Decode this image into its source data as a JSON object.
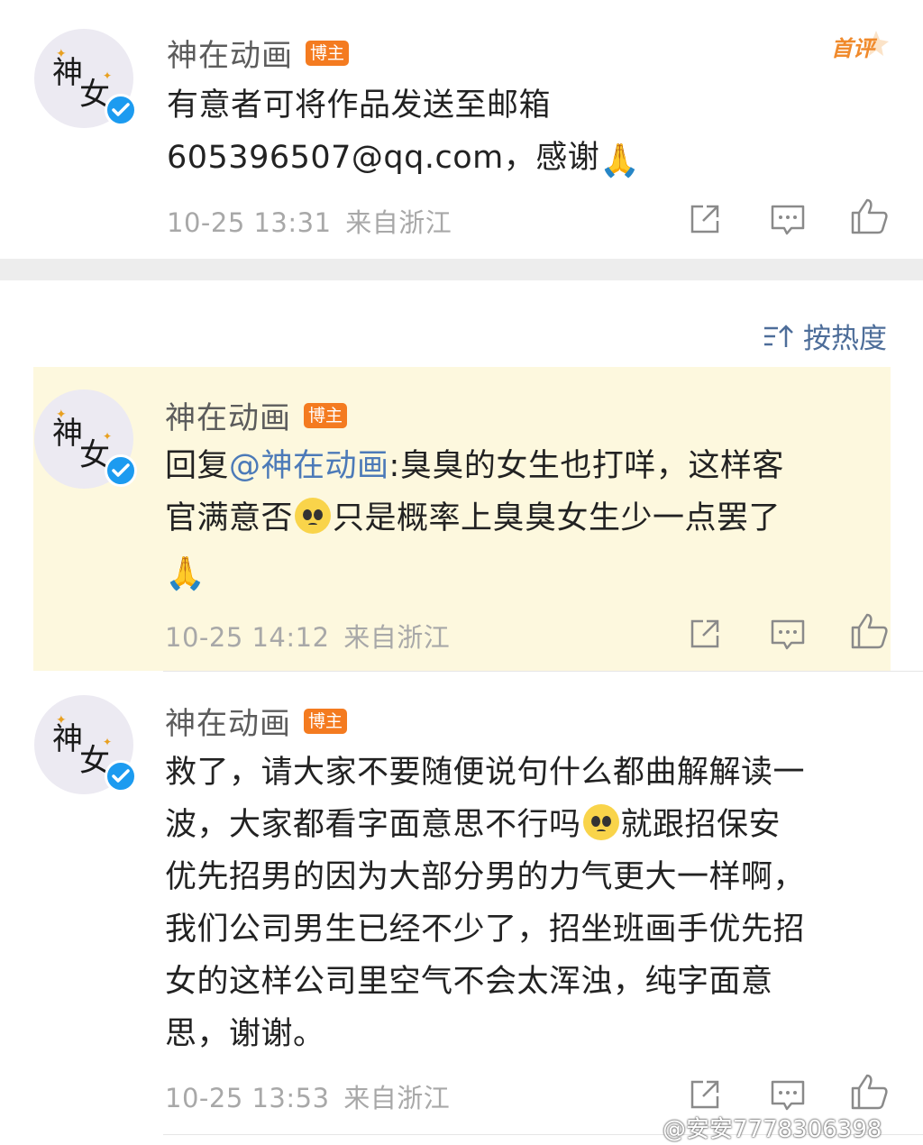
{
  "comments": [
    {
      "author": "神在动画",
      "tag": "博主",
      "lines": [
        "有意者可将作品发送至邮箱",
        "605396507@qq.com，感谢"
      ],
      "time": "10-25 13:31",
      "location": "来自浙江",
      "badge": "首评"
    },
    {
      "author": "神在动画",
      "tag": "博主",
      "reply_prefix": "回复",
      "mention": "@神在动画",
      "line1_rest": ":臭臭的女生也打咩，这样客",
      "line2_a": "官满意否",
      "line2_b": "只是概率上臭臭女生少一点罢了",
      "time": "10-25 14:12",
      "location": "来自浙江"
    },
    {
      "author": "神在动画",
      "tag": "博主",
      "line1": "救了，请大家不要随便说句什么都曲解解读一",
      "line2_a": "波，大家都看字面意思不行吗",
      "line2_b": "就跟招保安",
      "line3": "优先招男的因为大部分男的力气更大一样啊，",
      "line4": "我们公司男生已经不少了，招坐班画手优先招",
      "line5": "女的这样公司里空气不会太浑浊，纯字面意",
      "line6": "思，谢谢。",
      "time": "10-25 13:53",
      "location": "来自浙江"
    }
  ],
  "sort": {
    "label": "按热度"
  },
  "watermark": "@安安7778306398",
  "icons": [
    "share-icon",
    "comment-icon",
    "like-icon",
    "verified-icon",
    "sort-icon",
    "pray-emoji",
    "pleading-face-emoji"
  ],
  "colors": {
    "tag": "#f47b20",
    "mention": "#4c7ab8",
    "verified": "#1c9bf0",
    "highlight": "#fdf8de",
    "badge": "#f08a2c"
  }
}
